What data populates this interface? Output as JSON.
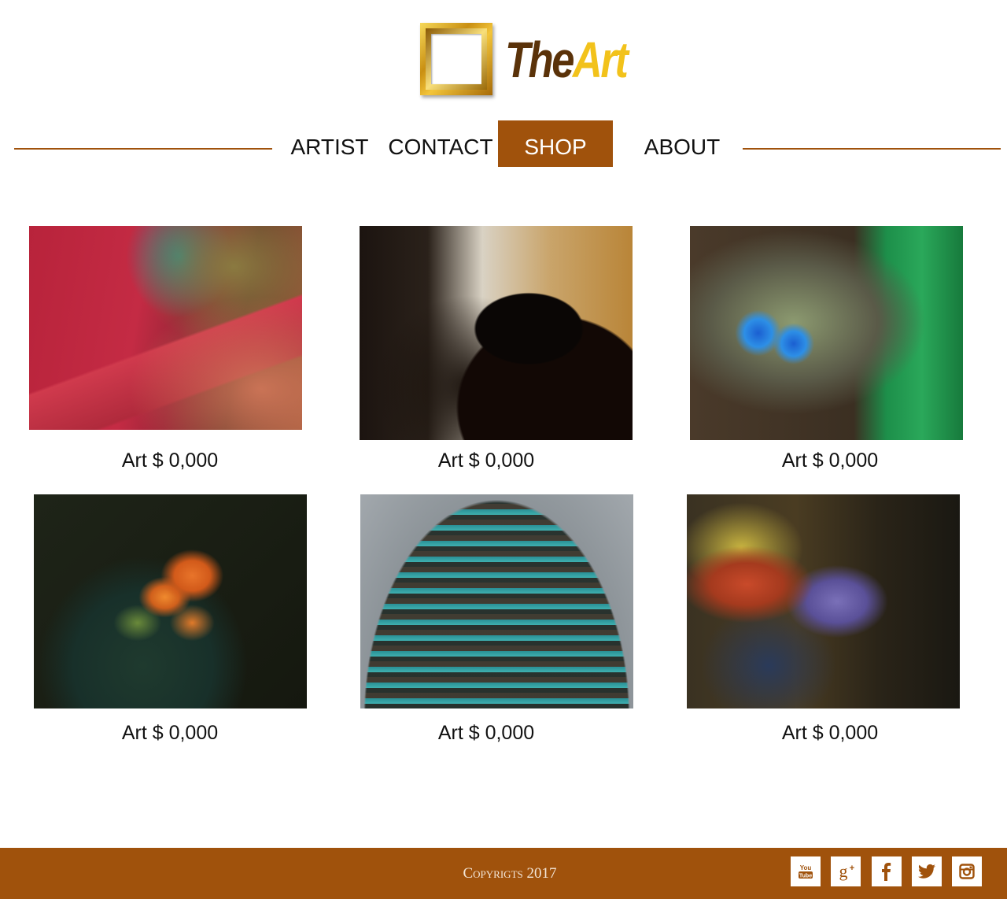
{
  "brand": {
    "logo_the": "The",
    "logo_art": "Art"
  },
  "nav": {
    "items": [
      {
        "label": "ARTIST",
        "active": false
      },
      {
        "label": "CONTACT",
        "active": false
      },
      {
        "label": "SHOP",
        "active": true
      },
      {
        "label": "ABOUT",
        "active": false
      }
    ]
  },
  "gallery": {
    "items": [
      {
        "price": "Art $ 0,000",
        "image": "red rusted metal machinery"
      },
      {
        "price": "Art $ 0,000",
        "image": "silhouette of woman at piano"
      },
      {
        "price": "Art $ 0,000",
        "image": "painted animal skull sculpture"
      },
      {
        "price": "Art $ 0,000",
        "image": "orange flower buds with dark leaves"
      },
      {
        "price": "Art $ 0,000",
        "image": "domed glass office building"
      },
      {
        "price": "Art $ 0,000",
        "image": "two musicians playing instruments"
      }
    ]
  },
  "footer": {
    "copyright": "Copyrigts 2017",
    "social": [
      "youtube-icon",
      "google-plus-icon",
      "facebook-icon",
      "twitter-icon",
      "instagram-icon"
    ]
  },
  "colors": {
    "accent": "#a0520c",
    "logo_gold": "#f2c21b",
    "logo_brown": "#5a3209"
  }
}
